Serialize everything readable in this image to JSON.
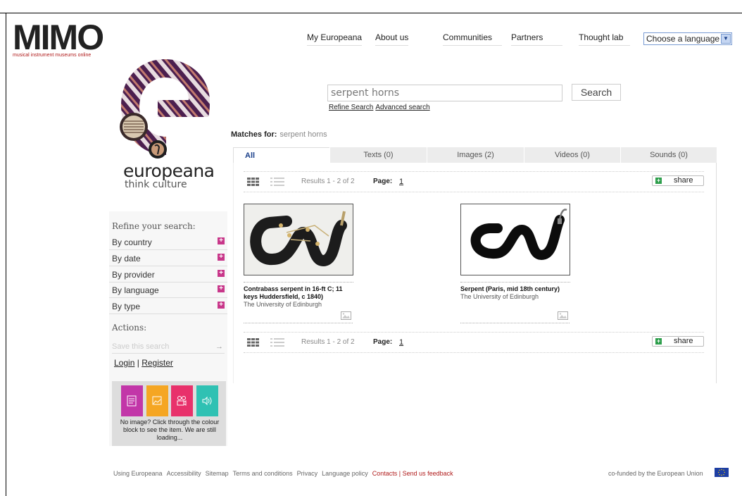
{
  "branding": {
    "mimo_word": "MIMO",
    "mimo_sub": "musical instrument museums online",
    "europeana_word": "europeana",
    "europeana_tag": "think culture"
  },
  "nav": {
    "items": [
      "My Europeana",
      "About us",
      "Communities",
      "Partners",
      "Thought lab"
    ],
    "language_select": "Choose a language"
  },
  "search": {
    "query": "serpent horns",
    "button": "Search",
    "refine_link": "Refine Search",
    "advanced_link": "Advanced search"
  },
  "matches": {
    "label": "Matches for:",
    "query": "serpent horns"
  },
  "tabs": [
    {
      "label": "All",
      "active": true
    },
    {
      "label": "Texts (0)"
    },
    {
      "label": "Images (2)"
    },
    {
      "label": "Videos (0)"
    },
    {
      "label": "Sounds (0)"
    }
  ],
  "results_bar": {
    "count": "Results 1 - 2 of 2",
    "page_label": "Page:",
    "page_number": "1",
    "share": "share"
  },
  "results": [
    {
      "title": "Contrabass serpent in 16-ft C; 11 keys Huddersfield, c 1840)",
      "provider": "The University of Edinburgh"
    },
    {
      "title": "Serpent (Paris, mid 18th century)",
      "provider": "The University of Edinburgh"
    }
  ],
  "sidebar": {
    "refine_heading": "Refine your search:",
    "facets": [
      "By country",
      "By date",
      "By provider",
      "By language",
      "By type"
    ],
    "actions_heading": "Actions:",
    "save_search": "Save this search",
    "login": "Login",
    "separator": "|",
    "register": "Register",
    "no_image_text": "No image? Click through the colour block to see the item. We are still loading..."
  },
  "footer": {
    "links": [
      "Using Europeana",
      "Accessibility",
      "Sitemap",
      "Terms and conditions",
      "Privacy",
      "Language policy"
    ],
    "contacts": "Contacts | Send us feedback",
    "funded": "co-funded by the European Union"
  },
  "colors": {
    "accent_blue": "#1a3f8a",
    "facet_plus": "#c8378a",
    "share_green": "#2d9e4b",
    "text_block": "#c236a8",
    "image_block": "#f5a623",
    "video_block": "#e8316b",
    "sound_block": "#2fc1b3"
  },
  "icons": {
    "grid_view": "grid-view-icon",
    "list_view": "list-view-icon",
    "image_type": "image-type-icon",
    "text": "text-type-icon",
    "image": "image-type-icon",
    "video": "video-type-icon",
    "sound": "sound-type-icon"
  }
}
